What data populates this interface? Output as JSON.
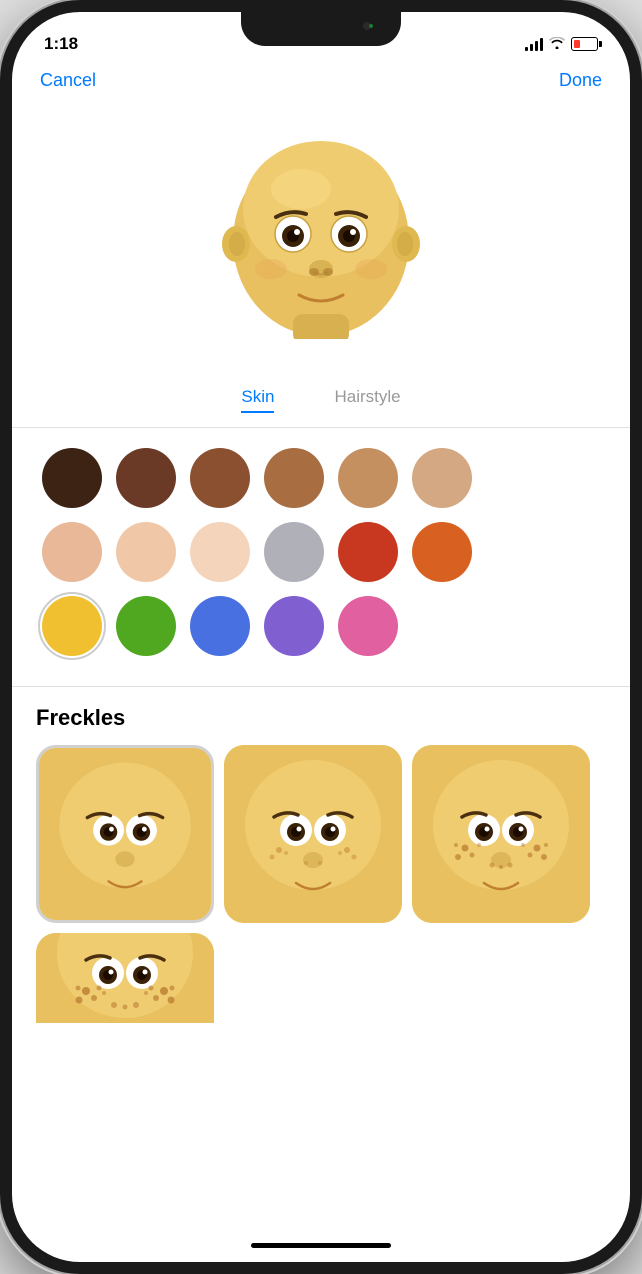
{
  "statusBar": {
    "time": "1:18",
    "batteryColor": "#ff3b30"
  },
  "nav": {
    "cancelLabel": "Cancel",
    "doneLabel": "Done"
  },
  "tabs": [
    {
      "id": "skin",
      "label": "Skin",
      "active": true
    },
    {
      "id": "hairstyle",
      "label": "Hairstyle",
      "active": false
    }
  ],
  "swatches": {
    "rows": [
      [
        {
          "color": "#3d2314",
          "selected": false
        },
        {
          "color": "#6b3a26",
          "selected": false
        },
        {
          "color": "#8b5030",
          "selected": false
        },
        {
          "color": "#a86d40",
          "selected": false
        },
        {
          "color": "#c49060",
          "selected": false
        },
        {
          "color": "#d4a882",
          "selected": false
        }
      ],
      [
        {
          "color": "#e8b898",
          "selected": false
        },
        {
          "color": "#f0c8a8",
          "selected": false
        },
        {
          "color": "#f5d4bc",
          "selected": false
        },
        {
          "color": "#b0b0b8",
          "selected": false
        },
        {
          "color": "#c83820",
          "selected": false
        },
        {
          "color": "#d86020",
          "selected": false
        }
      ],
      [
        {
          "color": "#f0c030",
          "selected": true
        },
        {
          "color": "#50a820",
          "selected": false
        },
        {
          "color": "#4870e0",
          "selected": false
        },
        {
          "color": "#8060d0",
          "selected": false
        },
        {
          "color": "#e060a0",
          "selected": false
        }
      ]
    ]
  },
  "freckles": {
    "title": "Freckles",
    "items": [
      {
        "id": "none",
        "selected": true
      },
      {
        "id": "light",
        "selected": false
      },
      {
        "id": "medium",
        "selected": false
      }
    ]
  }
}
